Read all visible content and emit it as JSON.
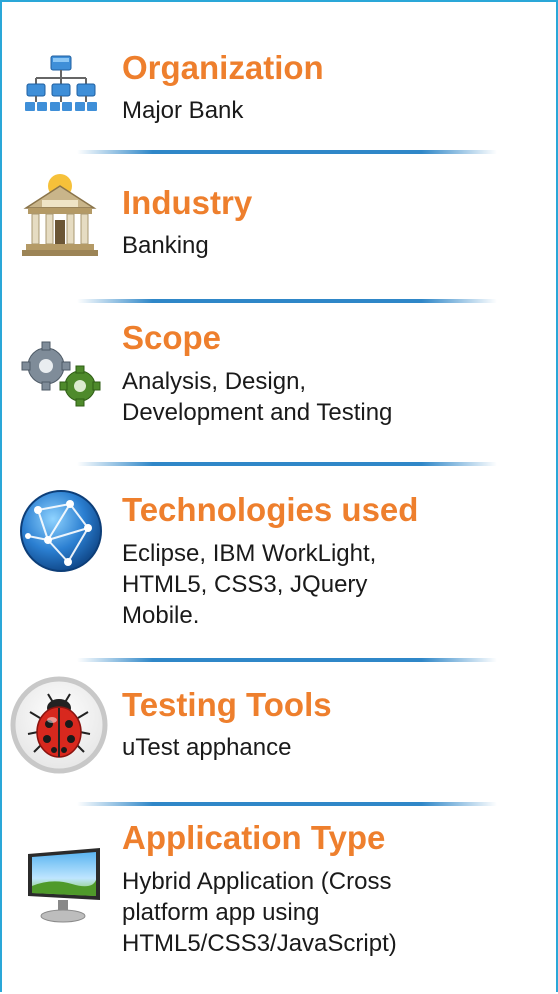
{
  "sections": [
    {
      "title": "Organization",
      "lines": [
        "Major Bank"
      ],
      "icon": "org-chart-icon"
    },
    {
      "title": "Industry",
      "lines": [
        "Banking"
      ],
      "icon": "bank-building-icon"
    },
    {
      "title": "Scope",
      "lines": [
        "Analysis, Design,",
        "Development and Testing"
      ],
      "icon": "gears-icon"
    },
    {
      "title": "Technologies used",
      "lines": [
        "Eclipse, IBM WorkLight,",
        "HTML5, CSS3, JQuery",
        "Mobile."
      ],
      "icon": "globe-network-icon"
    },
    {
      "title": "Testing Tools",
      "lines": [
        "uTest apphance"
      ],
      "icon": "ladybug-icon"
    },
    {
      "title": "Application Type",
      "lines": [
        "Hybrid Application (Cross",
        "platform app using",
        "HTML5/CSS3/JavaScript)"
      ],
      "icon": "monitor-icon"
    }
  ],
  "colors": {
    "title": "#ee7f2d",
    "border": "#2aa7d8",
    "separator": "#2f87c8"
  }
}
